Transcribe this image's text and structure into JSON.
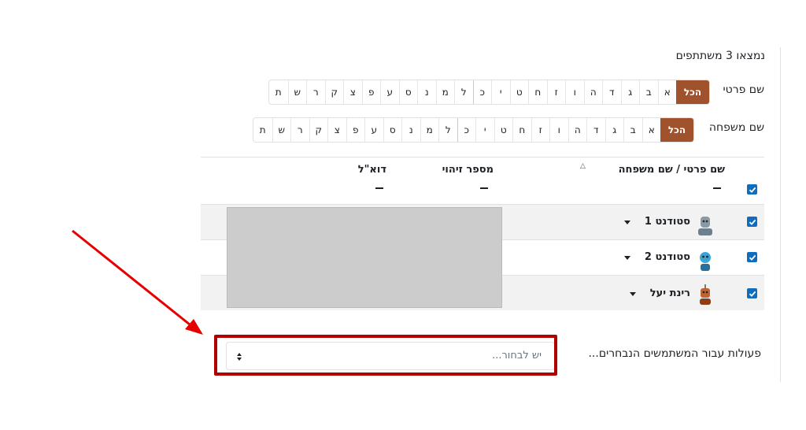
{
  "summary": "נמצאו 3 משתתפים",
  "first_name_filter": {
    "label": "שם פרטי",
    "all": "הכל",
    "letters": [
      "א",
      "ב",
      "ג",
      "ד",
      "ה",
      "ו",
      "ז",
      "ח",
      "ט",
      "י",
      "כ",
      "ל",
      "מ",
      "נ",
      "ס",
      "ע",
      "פ",
      "צ",
      "ק",
      "ר",
      "ש",
      "ת"
    ]
  },
  "last_name_filter": {
    "label": "שם משפחה",
    "all": "הכל",
    "letters": [
      "א",
      "ב",
      "ג",
      "ד",
      "ה",
      "ו",
      "ז",
      "ח",
      "ט",
      "י",
      "כ",
      "ל",
      "מ",
      "נ",
      "ס",
      "ע",
      "פ",
      "צ",
      "ק",
      "ר",
      "ש",
      "ת"
    ]
  },
  "table": {
    "col_name": "שם פרטי / שם משפחה",
    "col_id": "מספר זיהוי",
    "col_email": "דוא\"ל",
    "rows": [
      {
        "name": "סטודנט 1",
        "checked": true
      },
      {
        "name": "סטודנט 2",
        "checked": true
      },
      {
        "name": "רינת יעל",
        "checked": true
      }
    ]
  },
  "actions": {
    "label": "פעולות עבור המשתמשים הנבחרים...",
    "placeholder": "יש לבחור..."
  },
  "colors": {
    "accent": "#a0522d",
    "checkbox": "#0f6cbf",
    "highlight": "#b00000",
    "arrow": "#e60000"
  }
}
